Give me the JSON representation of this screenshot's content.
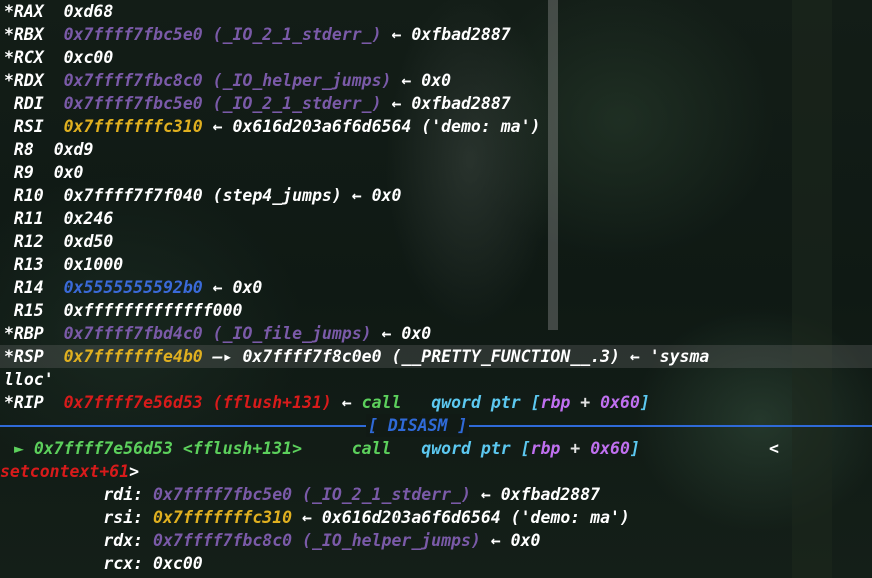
{
  "registers": [
    {
      "name": "*RAX",
      "value": "0xd68"
    },
    {
      "name": "*RBX",
      "addr": "0x7ffff7fbc5e0",
      "sym": "(_IO_2_1_stderr_)",
      "arrow": "←",
      "deref": "0xfbad2887"
    },
    {
      "name": "*RCX",
      "value": "0xc00"
    },
    {
      "name": "*RDX",
      "addr": "0x7ffff7fbc8c0",
      "sym": "(_IO_helper_jumps)",
      "arrow": "←",
      "deref": "0x0"
    },
    {
      "name": " RDI",
      "addr": "0x7ffff7fbc5e0",
      "sym": "(_IO_2_1_stderr_)",
      "arrow": "←",
      "deref": "0xfbad2887"
    },
    {
      "name": " RSI",
      "addr": "0x7fffffffc310",
      "arrow": "←",
      "deref": "0x616d203a6f6d6564 ('demo: ma')"
    },
    {
      "name": " R8 ",
      "value": "0xd9"
    },
    {
      "name": " R9 ",
      "value": "0x0"
    },
    {
      "name": " R10",
      "value": "0x7ffff7f7f040 (step4_jumps) ← 0x0"
    },
    {
      "name": " R11",
      "value": "0x246"
    },
    {
      "name": " R12",
      "value": "0xd50"
    },
    {
      "name": " R13",
      "value": "0x1000"
    },
    {
      "name": " R14",
      "addr": "0x5555555592b0",
      "arrow": "←",
      "deref": "0x0"
    },
    {
      "name": " R15",
      "value": "0xfffffffffffff000"
    },
    {
      "name": "*RBP",
      "addr": "0x7ffff7fbd4c0",
      "sym": "(_IO_file_jumps)",
      "arrow": "←",
      "deref": "0x0"
    },
    {
      "name": "*RSP",
      "addr": "0x7fffffffe4b0",
      "arrow": "—▸",
      "deref": "0x7ffff7f8c0e0 (__PRETTY_FUNCTION__.3) ← 'sysma",
      "wrap": "lloc'"
    },
    {
      "name": "*RIP",
      "addr": "0x7ffff7e56d53",
      "sym": "(fflush+131)",
      "arrow": "←",
      "op": "call",
      "operand_pre": "qword ptr [",
      "reg": "rbp",
      "operand_mid": " + ",
      "imm": "0x60",
      "operand_post": "]"
    }
  ],
  "disasm_label": "[ DISASM ]",
  "disasm": {
    "marker": "►",
    "addr": "0x7ffff7e56d53",
    "sym": "<fflush+131>",
    "op": "call",
    "operand_pre": "qword ptr [",
    "reg": "rbp",
    "operand_mid": " + ",
    "imm": "0x60",
    "operand_post": "]",
    "trail": "<",
    "cont_sym": "setcontext+61",
    "cont_end": ">"
  },
  "args": [
    {
      "name": "rdi:",
      "addr": "0x7ffff7fbc5e0",
      "sym": "(_IO_2_1_stderr_)",
      "arrow": "←",
      "deref": "0xfbad2887"
    },
    {
      "name": "rsi:",
      "addr": "0x7fffffffc310",
      "arrow": "←",
      "deref": "0x616d203a6f6d6564 ('demo: ma')"
    },
    {
      "name": "rdx:",
      "addr": "0x7ffff7fbc8c0",
      "sym": "(_IO_helper_jumps)",
      "arrow": "←",
      "deref": "0x0"
    },
    {
      "name": "rcx:",
      "addr": "0xc00"
    }
  ]
}
